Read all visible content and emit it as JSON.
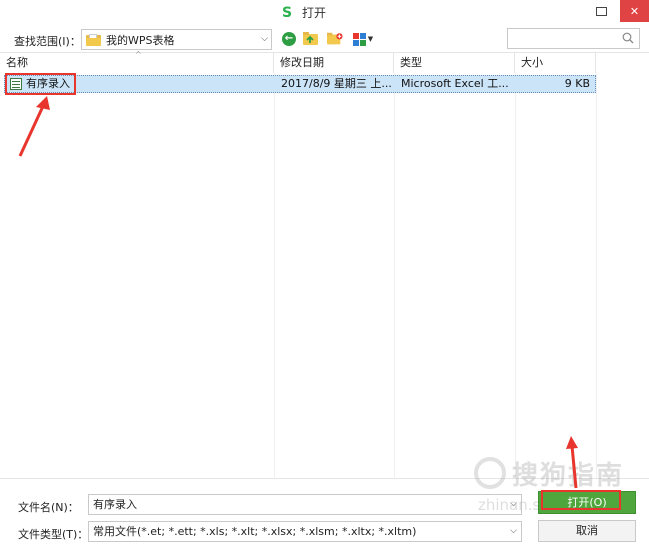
{
  "window": {
    "title": "打开",
    "close_glyph": "✕"
  },
  "toolbar": {
    "lookin_label": "查找范围(I)：",
    "lookin_value": "我的WPS表格",
    "search_placeholder": ""
  },
  "list": {
    "columns": [
      "名称",
      "修改日期",
      "类型",
      "大小"
    ],
    "rows": [
      {
        "name": "有序录入",
        "modified": "2017/8/9 星期三 上...",
        "type": "Microsoft Excel 工...",
        "size": "9 KB",
        "selected": true
      }
    ]
  },
  "bottom": {
    "filename_label": "文件名(N)：",
    "filename_value": "有序录入",
    "filetype_label": "文件类型(T)：",
    "filetype_value": "常用文件(*.et; *.ett; *.xls; *.xlt; *.xlsx; *.xlsm; *.xltx; *.xltm)",
    "open_label": "打开(O)",
    "cancel_label": "取消"
  },
  "watermark": {
    "brand": "搜狗指南",
    "site": "zhinan.sogou.com"
  },
  "colors": {
    "accent_green": "#4fa63c",
    "close_red": "#e04343",
    "selection": "#cce4f7",
    "highlight_red": "#e8352d"
  }
}
